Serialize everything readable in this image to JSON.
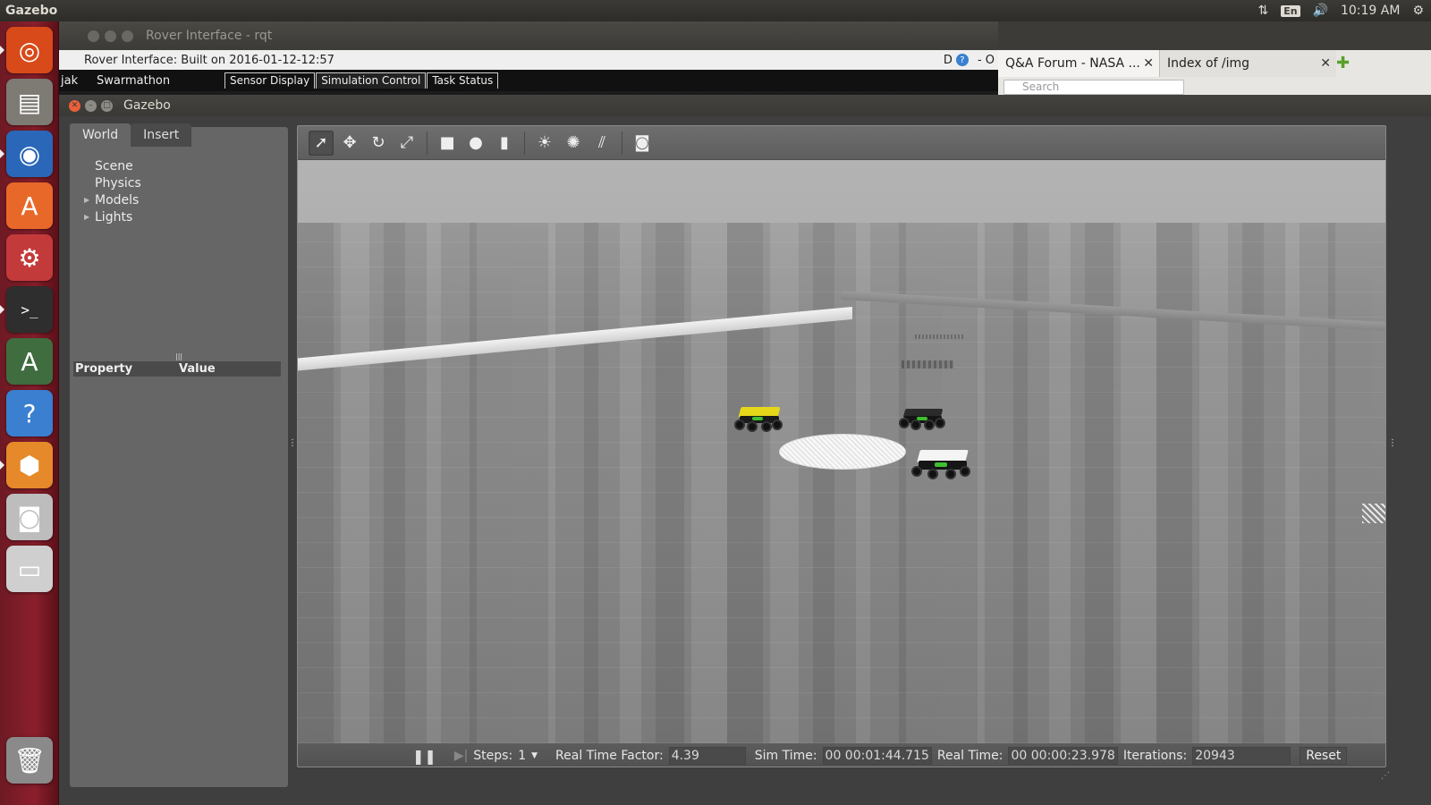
{
  "top_panel": {
    "app_title": "Gazebo",
    "keyboard_layout": "En",
    "clock": "10:19 AM"
  },
  "launcher": {
    "items": [
      {
        "name": "Dash",
        "icon": "ubuntu-logo-icon",
        "color": "#d84a1a"
      },
      {
        "name": "Files",
        "icon": "file-cabinet-icon",
        "color": "#7d7b74"
      },
      {
        "name": "Firefox",
        "icon": "firefox-icon",
        "color": "#2a67b8"
      },
      {
        "name": "Ubuntu Software Center",
        "icon": "software-center-icon",
        "color": "#e8682a"
      },
      {
        "name": "System Settings",
        "icon": "settings-tools-icon",
        "color": "#c33a3a"
      },
      {
        "name": "Terminal",
        "icon": "terminal-icon",
        "color": "#2e2e2e"
      },
      {
        "name": "Software Updater",
        "icon": "software-updater-icon",
        "color": "#3f6d3f"
      },
      {
        "name": "Help",
        "icon": "help-icon",
        "color": "#3a7fd0"
      },
      {
        "name": "Gazebo",
        "icon": "gazebo-icon",
        "color": "#e6892a"
      },
      {
        "name": "Screenshot",
        "icon": "camera-icon",
        "color": "#bdbdbd"
      },
      {
        "name": "Disk",
        "icon": "disk-icon",
        "color": "#cfcfcf"
      },
      {
        "name": "Trash",
        "icon": "trash-icon",
        "color": "#8a8a8a"
      }
    ]
  },
  "rqt_window": {
    "title": "Rover Interface - rqt",
    "subtitle": "Rover Interface: Built on 2016-01-12-12:57",
    "right_text": "D",
    "right_text2": "- O",
    "left_label": "jak",
    "swarmathon_label": "Swarmathon",
    "tabs": [
      "Sensor Display",
      "Simulation Control",
      "Task Status"
    ]
  },
  "browser": {
    "tabs": [
      {
        "label": "Q&A Forum - NASA ...",
        "close": "✕"
      },
      {
        "label": "Index of /img",
        "close": "✕"
      }
    ],
    "new_tab": "✚",
    "search_placeholder": "Search"
  },
  "gazebo": {
    "title": "Gazebo",
    "left_tabs": [
      "World",
      "Insert"
    ],
    "world_tree": [
      {
        "label": "Scene",
        "expandable": false
      },
      {
        "label": "Physics",
        "expandable": false
      },
      {
        "label": "Models",
        "expandable": true
      },
      {
        "label": "Lights",
        "expandable": true
      }
    ],
    "property_header": {
      "property": "Property",
      "value": "Value"
    },
    "toolbar": [
      {
        "name": "select-mode",
        "icon": "arrow-pointer-icon",
        "active": true
      },
      {
        "name": "translate-mode",
        "icon": "move-arrows-icon",
        "active": false
      },
      {
        "name": "rotate-mode",
        "icon": "rotate-icon",
        "active": false
      },
      {
        "name": "scale-mode",
        "icon": "scale-icon",
        "active": false
      },
      {
        "name": "box-shape",
        "icon": "box-icon",
        "active": false
      },
      {
        "name": "sphere-shape",
        "icon": "sphere-icon",
        "active": false
      },
      {
        "name": "cylinder-shape",
        "icon": "cylinder-icon",
        "active": false
      },
      {
        "name": "point-light",
        "icon": "point-light-icon",
        "active": false
      },
      {
        "name": "spot-light",
        "icon": "spot-light-icon",
        "active": false
      },
      {
        "name": "directional-light",
        "icon": "directional-light-icon",
        "active": false
      },
      {
        "name": "screenshot",
        "icon": "camera-icon",
        "active": false
      }
    ],
    "bottom_bar": {
      "steps_label": "Steps:",
      "steps_value": "1",
      "rtf_label": "Real Time Factor:",
      "rtf_value": "4.39",
      "sim_time_label": "Sim Time:",
      "sim_time_value": "00 00:01:44.715",
      "real_time_label": "Real Time:",
      "real_time_value": "00 00:00:23.978",
      "iterations_label": "Iterations:",
      "iterations_value": "20943",
      "reset_label": "Reset"
    }
  }
}
